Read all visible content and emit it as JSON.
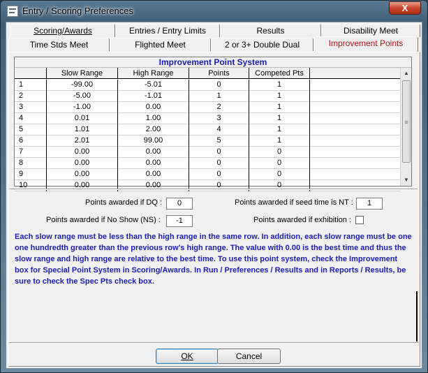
{
  "window": {
    "title": "Entry / Scoring Preferences",
    "close_label": "X"
  },
  "tabs_back": [
    {
      "label": "Scoring/Awards"
    },
    {
      "label": "Entries / Entry Limits"
    },
    {
      "label": "Results"
    },
    {
      "label": "Disability Meet"
    }
  ],
  "tabs_front": [
    {
      "label": "Time Stds Meet"
    },
    {
      "label": "Flighted Meet"
    },
    {
      "label": "2 or 3+ Double Dual"
    },
    {
      "label": "Improvement Points"
    }
  ],
  "grid": {
    "title": "Improvement Point System",
    "columns": [
      "",
      "Slow Range",
      "High Range",
      "Points",
      "Competed Pts"
    ],
    "rows": [
      [
        "1",
        "-99.00",
        "-5.01",
        "0",
        "1"
      ],
      [
        "2",
        "-5.00",
        "-1.01",
        "1",
        "1"
      ],
      [
        "3",
        "-1.00",
        "0.00",
        "2",
        "1"
      ],
      [
        "4",
        "0.01",
        "1.00",
        "3",
        "1"
      ],
      [
        "5",
        "1.01",
        "2.00",
        "4",
        "1"
      ],
      [
        "6",
        "2.01",
        "99.00",
        "5",
        "1"
      ],
      [
        "7",
        "0.00",
        "0.00",
        "0",
        "0"
      ],
      [
        "8",
        "0.00",
        "0.00",
        "0",
        "0"
      ],
      [
        "9",
        "0.00",
        "0.00",
        "0",
        "0"
      ],
      [
        "10",
        "0.00",
        "0.00",
        "0",
        "0"
      ]
    ]
  },
  "options": {
    "dq_label": "Points awarded if DQ :",
    "dq_value": "0",
    "ns_label": "Points awarded if No Show (NS) :",
    "ns_value": "-1",
    "nt_label": "Points awarded if seed time is NT :",
    "nt_value": "1",
    "exhibition_label": "Points awarded if exhibition :"
  },
  "info_text": "Each slow range must be less than the high range in the same row.  In addition, each slow range must be one one hundredth greater than the previous row's high range.  The value with 0.00 is the best time and thus the slow range and high range are relative to the best time. To use this point system, check the Improvement box for Special Point System in Scoring/Awards. In Run / Preferences / Results and in Reports / Results, be sure to check the Spec Pts check box.",
  "buttons": {
    "ok": "OK",
    "cancel": "Cancel"
  },
  "colors": {
    "active_tab": "#b5121b",
    "grid_title": "#1a1ab0",
    "info_text": "#1d1db5"
  }
}
